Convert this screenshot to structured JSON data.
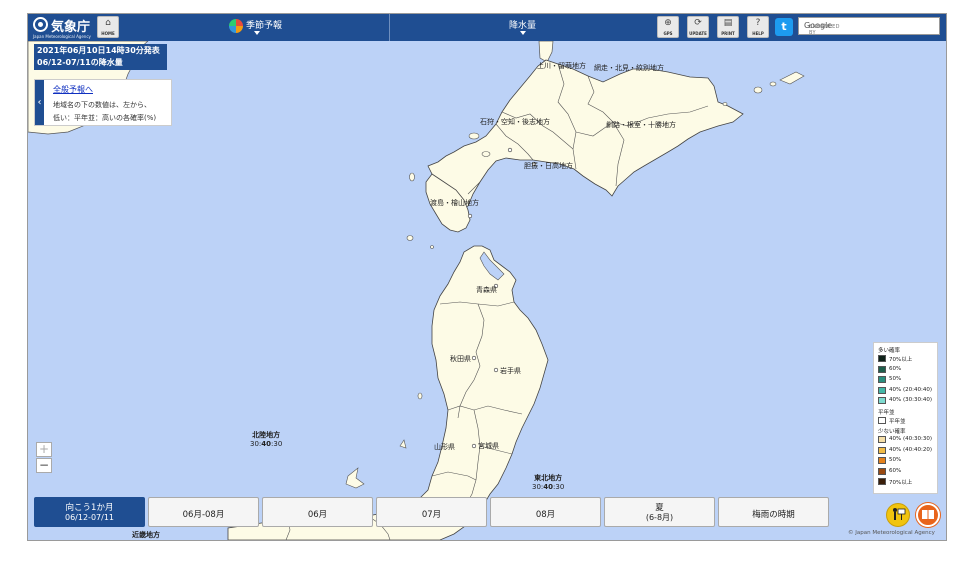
{
  "header": {
    "logo_text": "気象庁",
    "logo_sub": "Japan Meteorological Agency",
    "home_label": "HOME",
    "menu_forecast": "季節予報",
    "menu_element": "降水量",
    "gps_label": "GPS",
    "update_label": "UPDATE",
    "print_label": "PRINT",
    "help_label": "HELP",
    "search_prefix": "ENHANCED BY",
    "search_brand": "Google"
  },
  "issue": {
    "line1": "2021年06月10日14時30分発表",
    "line2": "06/12-07/11の降水量"
  },
  "info": {
    "link": "全般予報へ",
    "line1": "地域名の下の数値は、左から、",
    "line2": "低い：平年並：高いの各確率(%)"
  },
  "regions": {
    "wakkanai": "上川・留萌地方",
    "abashiri": "網走・北見・紋別地方",
    "ishikari": "石狩・空知・後志地方",
    "kushiro": "釧路・根室・十勝地方",
    "iburi": "胆振・日高地方",
    "oshima": "渡島・檜山地方",
    "aomori": "青森県",
    "akita": "秋田県",
    "iwate": "岩手県",
    "yamagata": "山形県",
    "miyagi": "宮城県",
    "kinki": "近畿地方"
  },
  "sea_labels": {
    "hokuriku_name": "北陸地方",
    "hokuriku_low": "30",
    "hokuriku_mid": "40",
    "hokuriku_high": "30",
    "tohoku_name": "東北地方",
    "tohoku_low": "30",
    "tohoku_mid": "40",
    "tohoku_high": "30",
    "sep": ":"
  },
  "zoom": {
    "in": "+",
    "out": "−"
  },
  "legend": {
    "more_title": "多い確率",
    "more": [
      {
        "label": "70%以上",
        "color": "#0d2118"
      },
      {
        "label": "60%",
        "color": "#1f5e4c"
      },
      {
        "label": "50%",
        "color": "#2a8f7f"
      },
      {
        "label": "40% (20:40:40)",
        "color": "#44b8a8"
      },
      {
        "label": "40% (30:30:40)",
        "color": "#7fdbd0"
      }
    ],
    "normal_title": "平年並",
    "normal": {
      "label": "平年並",
      "color": "#ffffff"
    },
    "less_title": "少ない確率",
    "less": [
      {
        "label": "40% (40:30:30)",
        "color": "#f6dfa8"
      },
      {
        "label": "40% (40:40:20)",
        "color": "#f2bc47"
      },
      {
        "label": "50%",
        "color": "#e5821d"
      },
      {
        "label": "60%",
        "color": "#9a4a12"
      },
      {
        "label": "70%以上",
        "color": "#3a1f0a"
      }
    ]
  },
  "tabs": [
    {
      "l1": "向こう1か月",
      "l2": "06/12-07/11",
      "active": true
    },
    {
      "l1": "06月-08月"
    },
    {
      "l1": "06月"
    },
    {
      "l1": "07月"
    },
    {
      "l1": "08月"
    },
    {
      "l1": "夏",
      "l2": "(6-8月)"
    },
    {
      "l1": "梅雨の時期"
    }
  ],
  "colors": {
    "sea": "#bcd2f7",
    "land": "#fdfbe6",
    "border": "#444444",
    "header": "#1f4e92"
  },
  "copyright": "© Japan Meteorological Agency"
}
